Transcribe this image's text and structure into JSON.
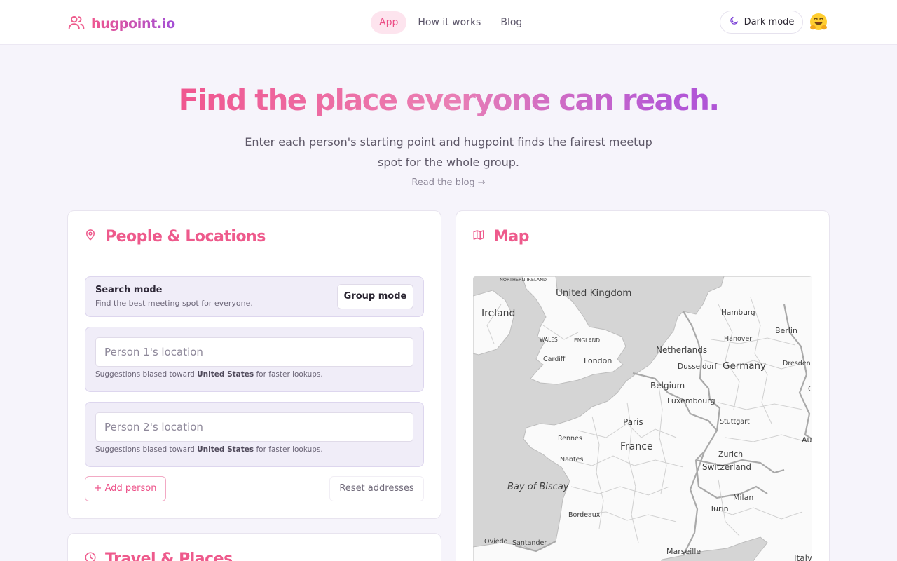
{
  "brand": {
    "name": "hugpoint.io"
  },
  "nav": {
    "items": [
      "App",
      "How it works",
      "Blog"
    ],
    "active": "App"
  },
  "header": {
    "dark_mode_label": "Dark mode",
    "emoji": "🤗"
  },
  "hero": {
    "title": "Find the place everyone can reach.",
    "subtitle": "Enter each person's starting point and hugpoint finds the fairest meetup spot for the whole group.",
    "blog_link": "Read the blog →"
  },
  "people_card": {
    "title": "People & Locations",
    "search_mode": {
      "title": "Search mode",
      "description": "Find the best meeting spot for everyone.",
      "toggle_label": "Group mode"
    },
    "people": [
      {
        "placeholder": "Person 1's location",
        "hint_prefix": "Suggestions biased toward",
        "hint_country": "United States",
        "hint_suffix": "for faster lookups."
      },
      {
        "placeholder": "Person 2's location",
        "hint_prefix": "Suggestions biased toward",
        "hint_country": "United States",
        "hint_suffix": "for faster lookups."
      }
    ],
    "add_person_label": "+ Add person",
    "reset_label": "Reset addresses"
  },
  "map_card": {
    "title": "Map",
    "labels": {
      "northern_ireland": "NORTHERN IRELAND",
      "united_kingdom": "United Kingdom",
      "ireland": "Ireland",
      "wales": "WALES",
      "england": "ENGLAND",
      "cardiff": "Cardiff",
      "london": "London",
      "hamburg": "Hamburg",
      "berlin": "Berlin",
      "hanover": "Hanover",
      "netherlands": "Netherlands",
      "dusseldorf": "Dusseldorf",
      "germany": "Germany",
      "dresden": "Dresden",
      "belgium": "Belgium",
      "luxembourg": "Luxembourg",
      "stuttgart": "Stuttgart",
      "paris": "Paris",
      "rennes": "Rennes",
      "france": "France",
      "zurich": "Zurich",
      "switzerland": "Switzerland",
      "nantes": "Nantes",
      "bay_of_biscay": "Bay of Biscay",
      "milan": "Milan",
      "turin": "Turin",
      "bordeaux": "Bordeaux",
      "oviedo": "Oviedo",
      "santander": "Santander",
      "marseille": "Marseille",
      "italy": "Italy",
      "au": "Au",
      "c": "C"
    }
  },
  "travel_card": {
    "title": "Travel & Places"
  },
  "colors": {
    "accent": "#ec4d86",
    "accent_purple": "#9a45d2",
    "background": "#f6f4fb"
  }
}
